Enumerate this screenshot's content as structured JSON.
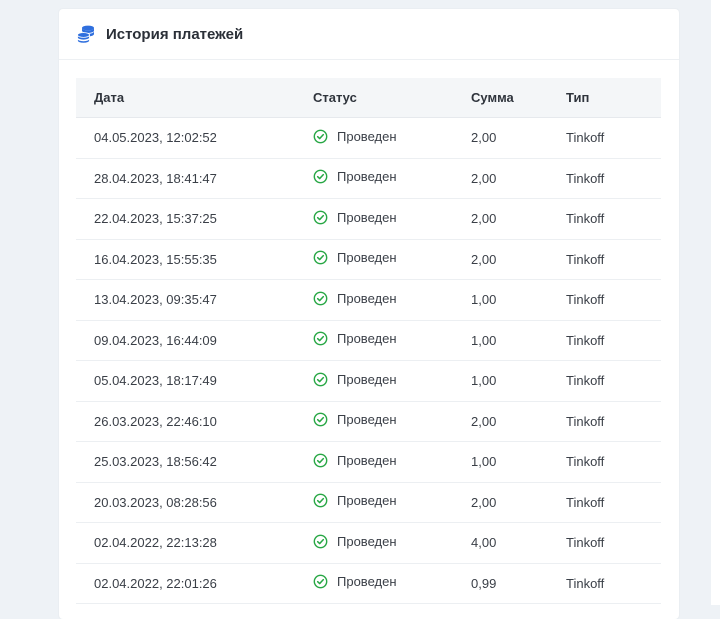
{
  "header": {
    "title": "История платежей",
    "icon": "coins-icon"
  },
  "colors": {
    "accent": "#2f6fde",
    "success": "#28a745",
    "page_bg": "#eef2f6",
    "header_bg": "#f4f6f8"
  },
  "table": {
    "columns": [
      "Дата",
      "Статус",
      "Сумма",
      "Тип"
    ],
    "rows": [
      {
        "date": "04.05.2023, 12:02:52",
        "status": "Проведен",
        "sum": "2,00",
        "type": "Tinkoff"
      },
      {
        "date": "28.04.2023, 18:41:47",
        "status": "Проведен",
        "sum": "2,00",
        "type": "Tinkoff"
      },
      {
        "date": "22.04.2023, 15:37:25",
        "status": "Проведен",
        "sum": "2,00",
        "type": "Tinkoff"
      },
      {
        "date": "16.04.2023, 15:55:35",
        "status": "Проведен",
        "sum": "2,00",
        "type": "Tinkoff"
      },
      {
        "date": "13.04.2023, 09:35:47",
        "status": "Проведен",
        "sum": "1,00",
        "type": "Tinkoff"
      },
      {
        "date": "09.04.2023, 16:44:09",
        "status": "Проведен",
        "sum": "1,00",
        "type": "Tinkoff"
      },
      {
        "date": "05.04.2023, 18:17:49",
        "status": "Проведен",
        "sum": "1,00",
        "type": "Tinkoff"
      },
      {
        "date": "26.03.2023, 22:46:10",
        "status": "Проведен",
        "sum": "2,00",
        "type": "Tinkoff"
      },
      {
        "date": "25.03.2023, 18:56:42",
        "status": "Проведен",
        "sum": "1,00",
        "type": "Tinkoff"
      },
      {
        "date": "20.03.2023, 08:28:56",
        "status": "Проведен",
        "sum": "2,00",
        "type": "Tinkoff"
      },
      {
        "date": "02.04.2022, 22:13:28",
        "status": "Проведен",
        "sum": "4,00",
        "type": "Tinkoff"
      },
      {
        "date": "02.04.2022, 22:01:26",
        "status": "Проведен",
        "sum": "0,99",
        "type": "Tinkoff"
      }
    ]
  }
}
